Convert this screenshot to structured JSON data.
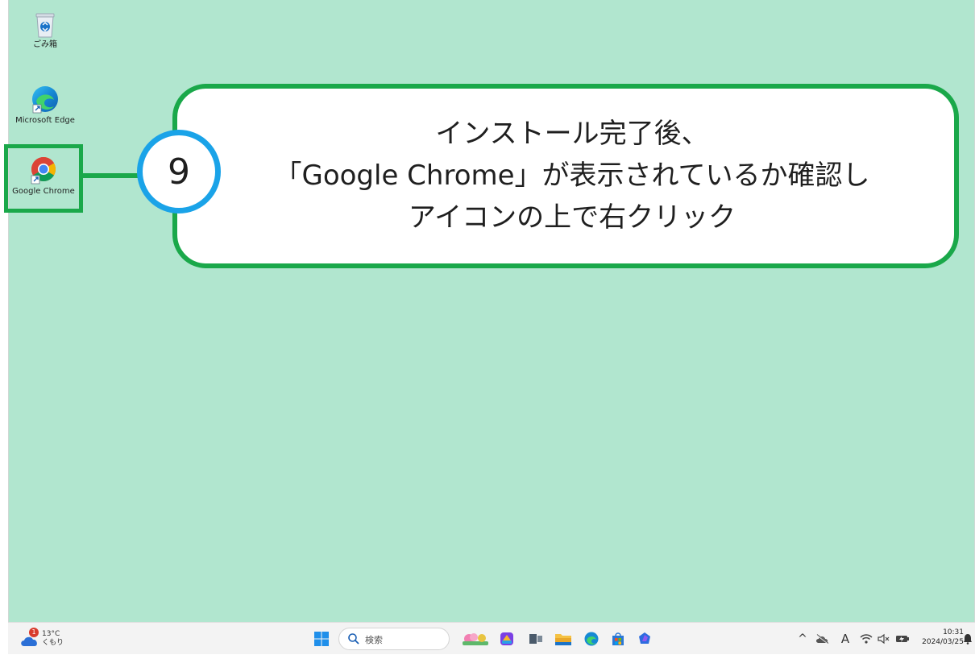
{
  "desktop": {
    "icons": [
      {
        "label": "ごみ箱",
        "icon": "recycle-bin-icon"
      },
      {
        "label": "Microsoft Edge",
        "icon": "edge-icon"
      },
      {
        "label": "Google Chrome",
        "icon": "chrome-icon"
      }
    ]
  },
  "callout": {
    "step_number": "9",
    "lines": [
      "インストール完了後、",
      "「Google Chrome」が表示されているか確認し",
      "アイコンの上で右クリック"
    ]
  },
  "taskbar": {
    "weather": {
      "badge": "1",
      "temperature": "13°C",
      "condition": "くもり"
    },
    "search_placeholder": "検索",
    "pinned": [
      "start-icon",
      "search-icon",
      "widget-landscape-icon",
      "copilot-app-icon",
      "task-view-icon",
      "file-explorer-icon",
      "edge-icon",
      "store-icon",
      "copilot-icon"
    ],
    "tray": {
      "chevron": "^",
      "ime": "A"
    },
    "clock": {
      "time": "10:31",
      "date": "2024/03/25"
    }
  },
  "colors": {
    "desktop_bg": "#b1e6cf",
    "highlight_green": "#1aa84a",
    "badge_blue": "#1aa3e8"
  }
}
